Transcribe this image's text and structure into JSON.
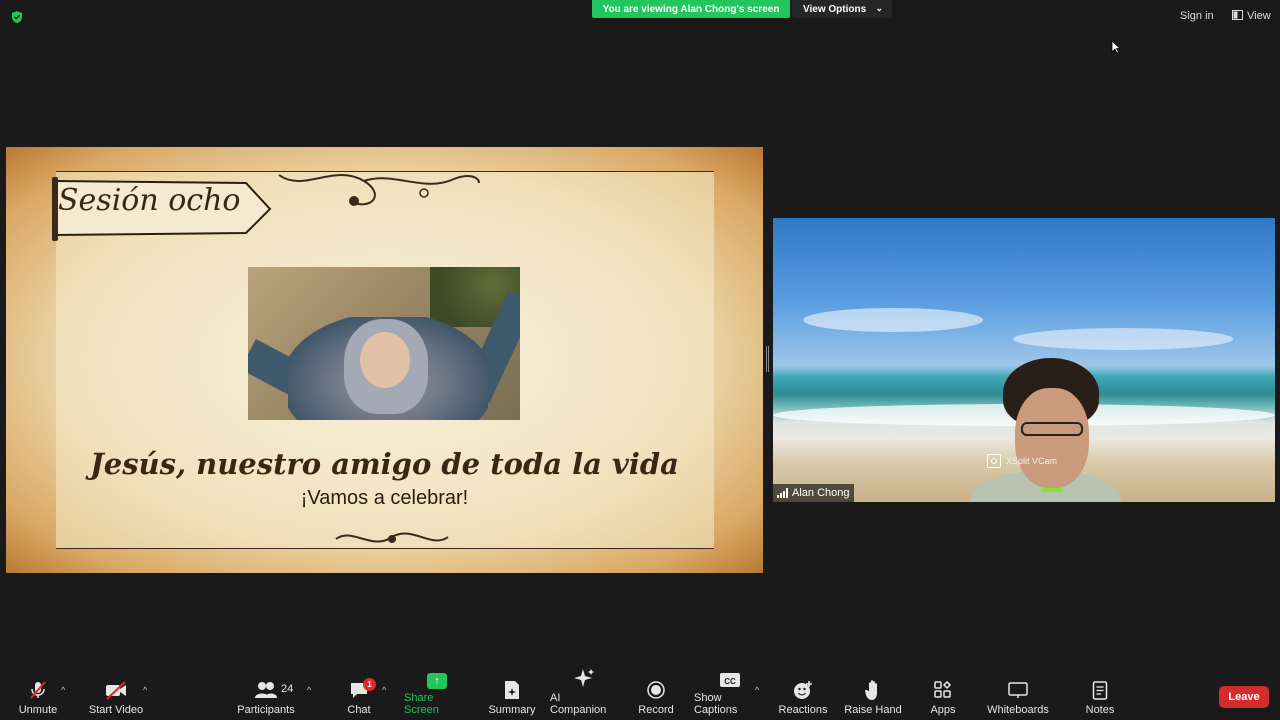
{
  "topbar": {
    "banner": "You are viewing Alan Chong's screen",
    "view_options": "View Options",
    "sign_in": "Sign in",
    "view": "View",
    "shield_color": "#22c55e"
  },
  "slide": {
    "session_label": "Sesión ocho",
    "title": "Jesús, nuestro amigo de toda la vida",
    "subtitle": "¡Vamos a celebrar!"
  },
  "video": {
    "participant_name": "Alan Chong",
    "camera_label": "XSplit VCam"
  },
  "toolbar": {
    "unmute": "Unmute",
    "start_video": "Start Video",
    "participants": "Participants",
    "participants_count": "24",
    "chat": "Chat",
    "chat_badge": "1",
    "share_screen": "Share Screen",
    "summary": "Summary",
    "ai_companion": "AI Companion",
    "record": "Record",
    "show_captions": "Show Captions",
    "reactions": "Reactions",
    "raise_hand": "Raise Hand",
    "apps": "Apps",
    "whiteboards": "Whiteboards",
    "notes": "Notes",
    "leave": "Leave",
    "leave_color": "#d42c2c",
    "share_color": "#22c55e"
  }
}
